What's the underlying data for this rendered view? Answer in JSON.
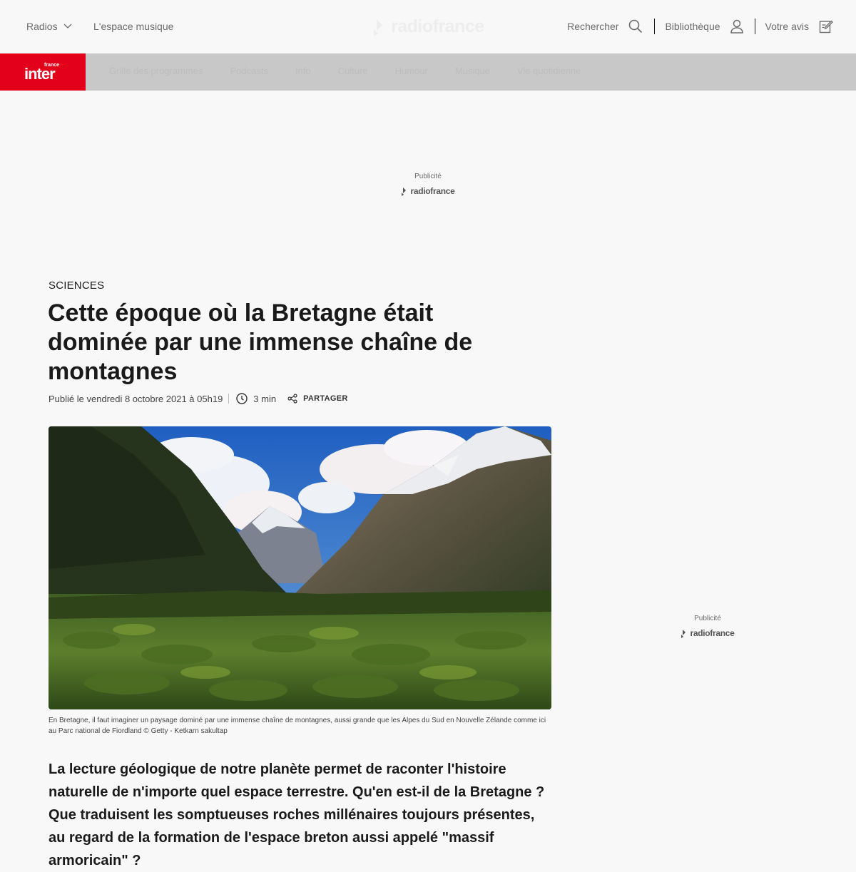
{
  "header": {
    "radios_label": "Radios",
    "espace_label": "L'espace musique",
    "logo_text": "radiofrance",
    "search_label": "Rechercher",
    "library_label": "Bibliothèque",
    "feedback_label": "Votre avis"
  },
  "nav": {
    "logo_small": "france",
    "logo_word": "inter",
    "links": [
      "Grille des programmes",
      "Podcasts",
      "Info",
      "Culture",
      "Humour",
      "Musique",
      "Vie quotidienne"
    ]
  },
  "ads": {
    "top": {
      "label": "Publicité",
      "brand": "radiofrance"
    },
    "side": {
      "label": "Publicité",
      "brand": "radiofrance"
    }
  },
  "article": {
    "category": "SCIENCES",
    "title": "Cette époque où la Bretagne était dominée par une immense chaîne de montagnes",
    "published": "Publié le vendredi 8 octobre 2021 à 05h19",
    "duration": "3 min",
    "share_label": "PARTAGER",
    "image_caption": "En Bretagne, il faut imaginer un paysage dominé par une immense chaîne de montagnes, aussi grande que les Alpes du Sud en Nouvelle Zélande comme ici au Parc national de Fiordland © Getty - Ketkarn sakultap",
    "chapo": "La lecture géologique de notre planète permet de raconter l'histoire naturelle de n'importe quel espace terrestre. Qu'en est-il de la Bretagne ? Que traduisent les somptueuses roches millénaires toujours présentes, au regard de la formation de l'espace breton aussi appelé \"massif armoricain\" ?"
  },
  "colors": {
    "brand_red": "#e2001a",
    "nav_gray": "#c8c8c8",
    "background": "#f8f8f8"
  }
}
